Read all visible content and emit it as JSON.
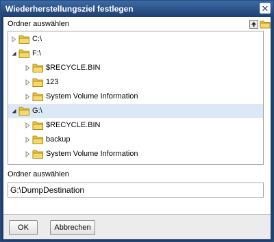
{
  "window": {
    "title": "Wiederherstellungsziel festlegen",
    "close_icon": "close-icon"
  },
  "folder_section": {
    "label": "Ordner auswählen",
    "up_icon": "up-arrow-icon",
    "new_folder_icon": "new-folder-icon"
  },
  "tree": {
    "items": [
      {
        "label": "C:\\",
        "level": 0,
        "state": "collapsed",
        "selected": false
      },
      {
        "label": "F:\\",
        "level": 0,
        "state": "expanded",
        "selected": false
      },
      {
        "label": "$RECYCLE.BIN",
        "level": 1,
        "state": "collapsed",
        "selected": false
      },
      {
        "label": "123",
        "level": 1,
        "state": "collapsed",
        "selected": false
      },
      {
        "label": "System Volume Information",
        "level": 1,
        "state": "collapsed",
        "selected": false
      },
      {
        "label": "G:\\",
        "level": 0,
        "state": "expanded",
        "selected": true
      },
      {
        "label": "$RECYCLE.BIN",
        "level": 1,
        "state": "collapsed",
        "selected": false
      },
      {
        "label": "backup",
        "level": 1,
        "state": "collapsed",
        "selected": false
      },
      {
        "label": "System Volume Information",
        "level": 1,
        "state": "collapsed",
        "selected": false
      }
    ]
  },
  "path_section": {
    "label": "Ordner auswählen",
    "value": "G:\\DumpDestination"
  },
  "buttons": {
    "ok": "OK",
    "cancel": "Abbrechen"
  },
  "colors": {
    "title_bar": "#1f3f6e",
    "selection": "#dde8f6",
    "folder": "#f2c531"
  }
}
